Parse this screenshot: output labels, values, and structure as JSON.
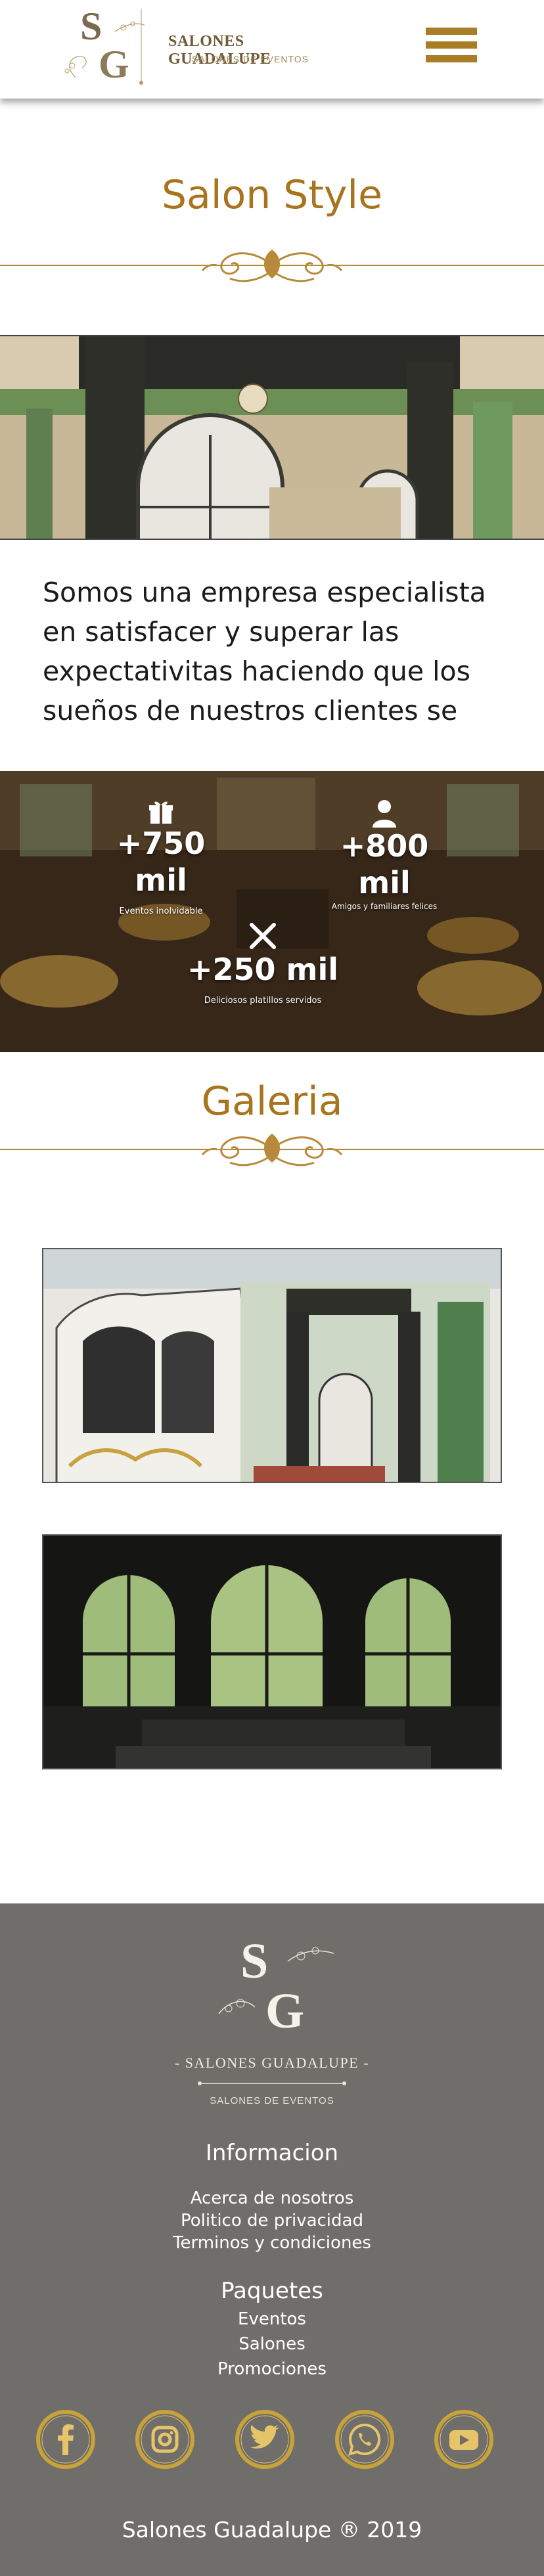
{
  "header": {
    "logo_monogram": "SG",
    "brand_name": "SALONES GUADALUPE",
    "brand_subtitle": "SALONES DE EVENTOS"
  },
  "about": {
    "title": "Salon Style",
    "intro_text": "Somos una empresa especialista en satisfacer y superar las expectativitas haciendo que los sueños de nuestros clientes se"
  },
  "stats": [
    {
      "value": "+750 mil",
      "label": "Eventos inolvidable",
      "icon": "gift-icon"
    },
    {
      "value": "+800 mil",
      "label": "Amigos y familiares felices",
      "icon": "user-icon"
    },
    {
      "value": "+250 mil",
      "label": "Deliciosos platillos servidos",
      "icon": "cutlery-icon"
    }
  ],
  "gallery": {
    "title": "Galeria"
  },
  "footer": {
    "brand_name": "- SALONES GUADALUPE -",
    "brand_subtitle": "SALONES DE EVENTOS",
    "info_heading": "Informacion",
    "info_links": [
      "Acerca de nosotros",
      "Politico de privacidad",
      "Terminos y condiciones"
    ],
    "packages_heading": "Paquetes",
    "packages_links": [
      "Eventos",
      "Salones",
      "Promociones"
    ],
    "social": [
      "facebook-icon",
      "instagram-icon",
      "twitter-icon",
      "whatsapp-icon",
      "youtube-icon"
    ],
    "copyright": "Salones Guadalupe ® 2019"
  },
  "colors": {
    "gold": "#a8741d",
    "gold_dark": "#a97c26",
    "footer_bg": "#6f6e6a"
  }
}
